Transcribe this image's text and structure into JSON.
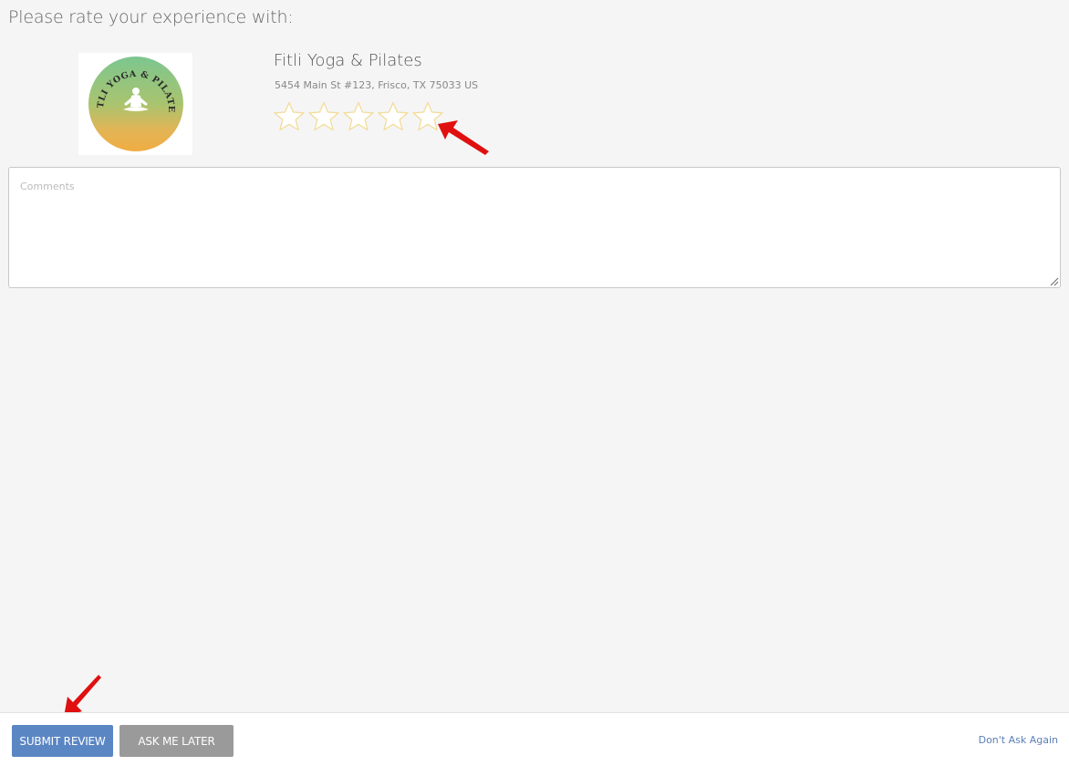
{
  "prompt": "Please rate your experience with:",
  "business": {
    "name": "Fitli Yoga & Pilates",
    "address": "5454 Main St #123, Frisco, TX 75033 US",
    "logo_text": "FITLI YOGA & PILATES"
  },
  "rating": {
    "max": 5,
    "value": 0,
    "star_outline_color": "#f3dc9a"
  },
  "comments": {
    "placeholder": "Comments",
    "value": ""
  },
  "footer": {
    "submit_label": "SUBMIT REVIEW",
    "later_label": "ASK ME LATER",
    "dont_ask_label": "Don't Ask Again"
  },
  "colors": {
    "primary": "#5b86c4",
    "secondary": "#9a9a9a",
    "link": "#5b7fb8",
    "annotation": "#e01010"
  }
}
